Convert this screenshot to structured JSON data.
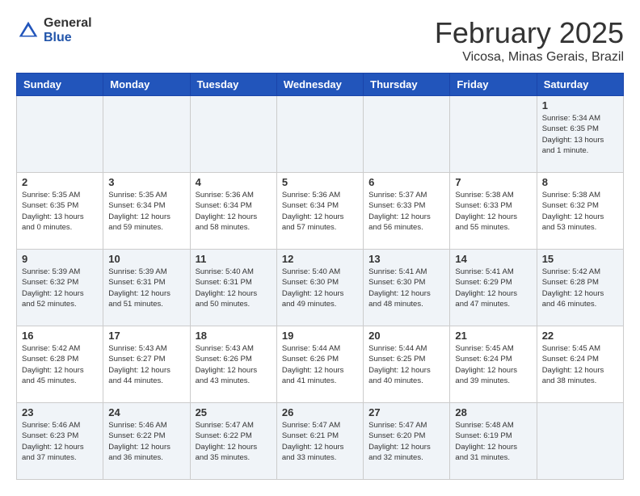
{
  "header": {
    "logo_general": "General",
    "logo_blue": "Blue",
    "month_title": "February 2025",
    "location": "Vicosa, Minas Gerais, Brazil"
  },
  "weekdays": [
    "Sunday",
    "Monday",
    "Tuesday",
    "Wednesday",
    "Thursday",
    "Friday",
    "Saturday"
  ],
  "weeks": [
    [
      {
        "day": "",
        "info": ""
      },
      {
        "day": "",
        "info": ""
      },
      {
        "day": "",
        "info": ""
      },
      {
        "day": "",
        "info": ""
      },
      {
        "day": "",
        "info": ""
      },
      {
        "day": "",
        "info": ""
      },
      {
        "day": "1",
        "info": "Sunrise: 5:34 AM\nSunset: 6:35 PM\nDaylight: 13 hours\nand 1 minute."
      }
    ],
    [
      {
        "day": "2",
        "info": "Sunrise: 5:35 AM\nSunset: 6:35 PM\nDaylight: 13 hours\nand 0 minutes."
      },
      {
        "day": "3",
        "info": "Sunrise: 5:35 AM\nSunset: 6:34 PM\nDaylight: 12 hours\nand 59 minutes."
      },
      {
        "day": "4",
        "info": "Sunrise: 5:36 AM\nSunset: 6:34 PM\nDaylight: 12 hours\nand 58 minutes."
      },
      {
        "day": "5",
        "info": "Sunrise: 5:36 AM\nSunset: 6:34 PM\nDaylight: 12 hours\nand 57 minutes."
      },
      {
        "day": "6",
        "info": "Sunrise: 5:37 AM\nSunset: 6:33 PM\nDaylight: 12 hours\nand 56 minutes."
      },
      {
        "day": "7",
        "info": "Sunrise: 5:38 AM\nSunset: 6:33 PM\nDaylight: 12 hours\nand 55 minutes."
      },
      {
        "day": "8",
        "info": "Sunrise: 5:38 AM\nSunset: 6:32 PM\nDaylight: 12 hours\nand 53 minutes."
      }
    ],
    [
      {
        "day": "9",
        "info": "Sunrise: 5:39 AM\nSunset: 6:32 PM\nDaylight: 12 hours\nand 52 minutes."
      },
      {
        "day": "10",
        "info": "Sunrise: 5:39 AM\nSunset: 6:31 PM\nDaylight: 12 hours\nand 51 minutes."
      },
      {
        "day": "11",
        "info": "Sunrise: 5:40 AM\nSunset: 6:31 PM\nDaylight: 12 hours\nand 50 minutes."
      },
      {
        "day": "12",
        "info": "Sunrise: 5:40 AM\nSunset: 6:30 PM\nDaylight: 12 hours\nand 49 minutes."
      },
      {
        "day": "13",
        "info": "Sunrise: 5:41 AM\nSunset: 6:30 PM\nDaylight: 12 hours\nand 48 minutes."
      },
      {
        "day": "14",
        "info": "Sunrise: 5:41 AM\nSunset: 6:29 PM\nDaylight: 12 hours\nand 47 minutes."
      },
      {
        "day": "15",
        "info": "Sunrise: 5:42 AM\nSunset: 6:28 PM\nDaylight: 12 hours\nand 46 minutes."
      }
    ],
    [
      {
        "day": "16",
        "info": "Sunrise: 5:42 AM\nSunset: 6:28 PM\nDaylight: 12 hours\nand 45 minutes."
      },
      {
        "day": "17",
        "info": "Sunrise: 5:43 AM\nSunset: 6:27 PM\nDaylight: 12 hours\nand 44 minutes."
      },
      {
        "day": "18",
        "info": "Sunrise: 5:43 AM\nSunset: 6:26 PM\nDaylight: 12 hours\nand 43 minutes."
      },
      {
        "day": "19",
        "info": "Sunrise: 5:44 AM\nSunset: 6:26 PM\nDaylight: 12 hours\nand 41 minutes."
      },
      {
        "day": "20",
        "info": "Sunrise: 5:44 AM\nSunset: 6:25 PM\nDaylight: 12 hours\nand 40 minutes."
      },
      {
        "day": "21",
        "info": "Sunrise: 5:45 AM\nSunset: 6:24 PM\nDaylight: 12 hours\nand 39 minutes."
      },
      {
        "day": "22",
        "info": "Sunrise: 5:45 AM\nSunset: 6:24 PM\nDaylight: 12 hours\nand 38 minutes."
      }
    ],
    [
      {
        "day": "23",
        "info": "Sunrise: 5:46 AM\nSunset: 6:23 PM\nDaylight: 12 hours\nand 37 minutes."
      },
      {
        "day": "24",
        "info": "Sunrise: 5:46 AM\nSunset: 6:22 PM\nDaylight: 12 hours\nand 36 minutes."
      },
      {
        "day": "25",
        "info": "Sunrise: 5:47 AM\nSunset: 6:22 PM\nDaylight: 12 hours\nand 35 minutes."
      },
      {
        "day": "26",
        "info": "Sunrise: 5:47 AM\nSunset: 6:21 PM\nDaylight: 12 hours\nand 33 minutes."
      },
      {
        "day": "27",
        "info": "Sunrise: 5:47 AM\nSunset: 6:20 PM\nDaylight: 12 hours\nand 32 minutes."
      },
      {
        "day": "28",
        "info": "Sunrise: 5:48 AM\nSunset: 6:19 PM\nDaylight: 12 hours\nand 31 minutes."
      },
      {
        "day": "",
        "info": ""
      }
    ]
  ],
  "alt_rows": [
    0,
    2,
    4
  ]
}
